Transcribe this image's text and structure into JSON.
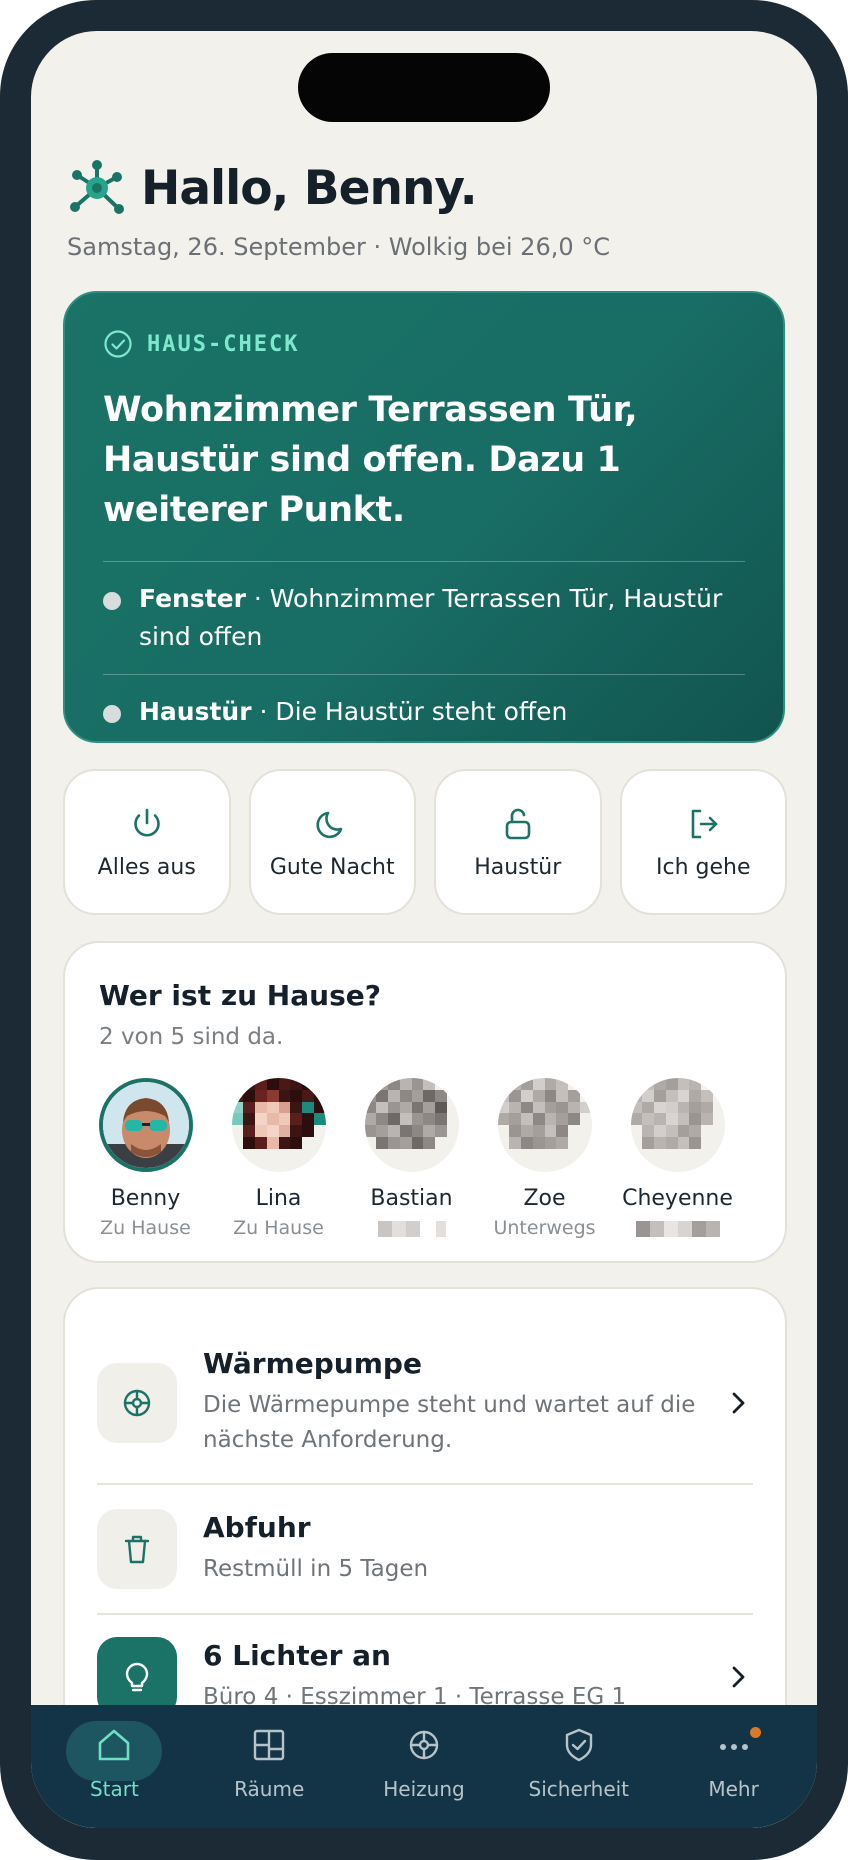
{
  "header": {
    "greeting": "Hallo, Benny.",
    "subline": "Samstag, 26. September · Wolkig bei 26,0 °C"
  },
  "house_check": {
    "label": "HAUS-CHECK",
    "title": "Wohnzimmer Terrassen Tür, Haustür sind offen. Dazu 1 weiterer Punkt.",
    "issues": [
      {
        "name": "Fenster",
        "text": " · Wohnzimmer Terrassen Tür, Haustür sind offen"
      },
      {
        "name": "Haustür",
        "text": " · Die Haustür steht offen"
      }
    ]
  },
  "quick_actions": [
    {
      "label": "Alles aus",
      "icon": "power-icon"
    },
    {
      "label": "Gute Nacht",
      "icon": "moon-icon"
    },
    {
      "label": "Haustür",
      "icon": "unlock-icon"
    },
    {
      "label": "Ich gehe",
      "icon": "leave-icon"
    }
  ],
  "presence": {
    "title": "Wer ist zu Hause?",
    "summary": "2 von 5 sind da.",
    "people": [
      {
        "name": "Benny",
        "status": "Zu Hause"
      },
      {
        "name": "Lina",
        "status": "Zu Hause"
      },
      {
        "name": "Bastian",
        "status": ""
      },
      {
        "name": "Zoe",
        "status": "Unterwegs"
      },
      {
        "name": "Cheyenne",
        "status": ""
      }
    ]
  },
  "status_list": [
    {
      "title": "Wärmepumpe",
      "desc": "Die Wärmepumpe steht und wartet auf die nächste Anforderung.",
      "icon": "heat-pump-icon",
      "chevron": true
    },
    {
      "title": "Abfuhr",
      "desc": "Restmüll in 5 Tagen",
      "icon": "trash-icon",
      "chevron": false
    },
    {
      "title": "6 Lichter an",
      "desc": "Büro 4 · Esszimmer 1 · Terrasse EG 1",
      "icon": "lightbulb-icon",
      "chevron": true
    }
  ],
  "tabs": [
    {
      "label": "Start",
      "icon": "home-icon",
      "active": true
    },
    {
      "label": "Räume",
      "icon": "rooms-icon",
      "active": false
    },
    {
      "label": "Heizung",
      "icon": "heating-icon",
      "active": false
    },
    {
      "label": "Sicherheit",
      "icon": "shield-icon",
      "active": false
    },
    {
      "label": "Mehr",
      "icon": "more-icon",
      "active": false
    }
  ],
  "colors": {
    "accent": "#1a7366",
    "accent_light": "#7ee8cf",
    "tabbar": "#133447",
    "background": "#f3f1ec"
  }
}
